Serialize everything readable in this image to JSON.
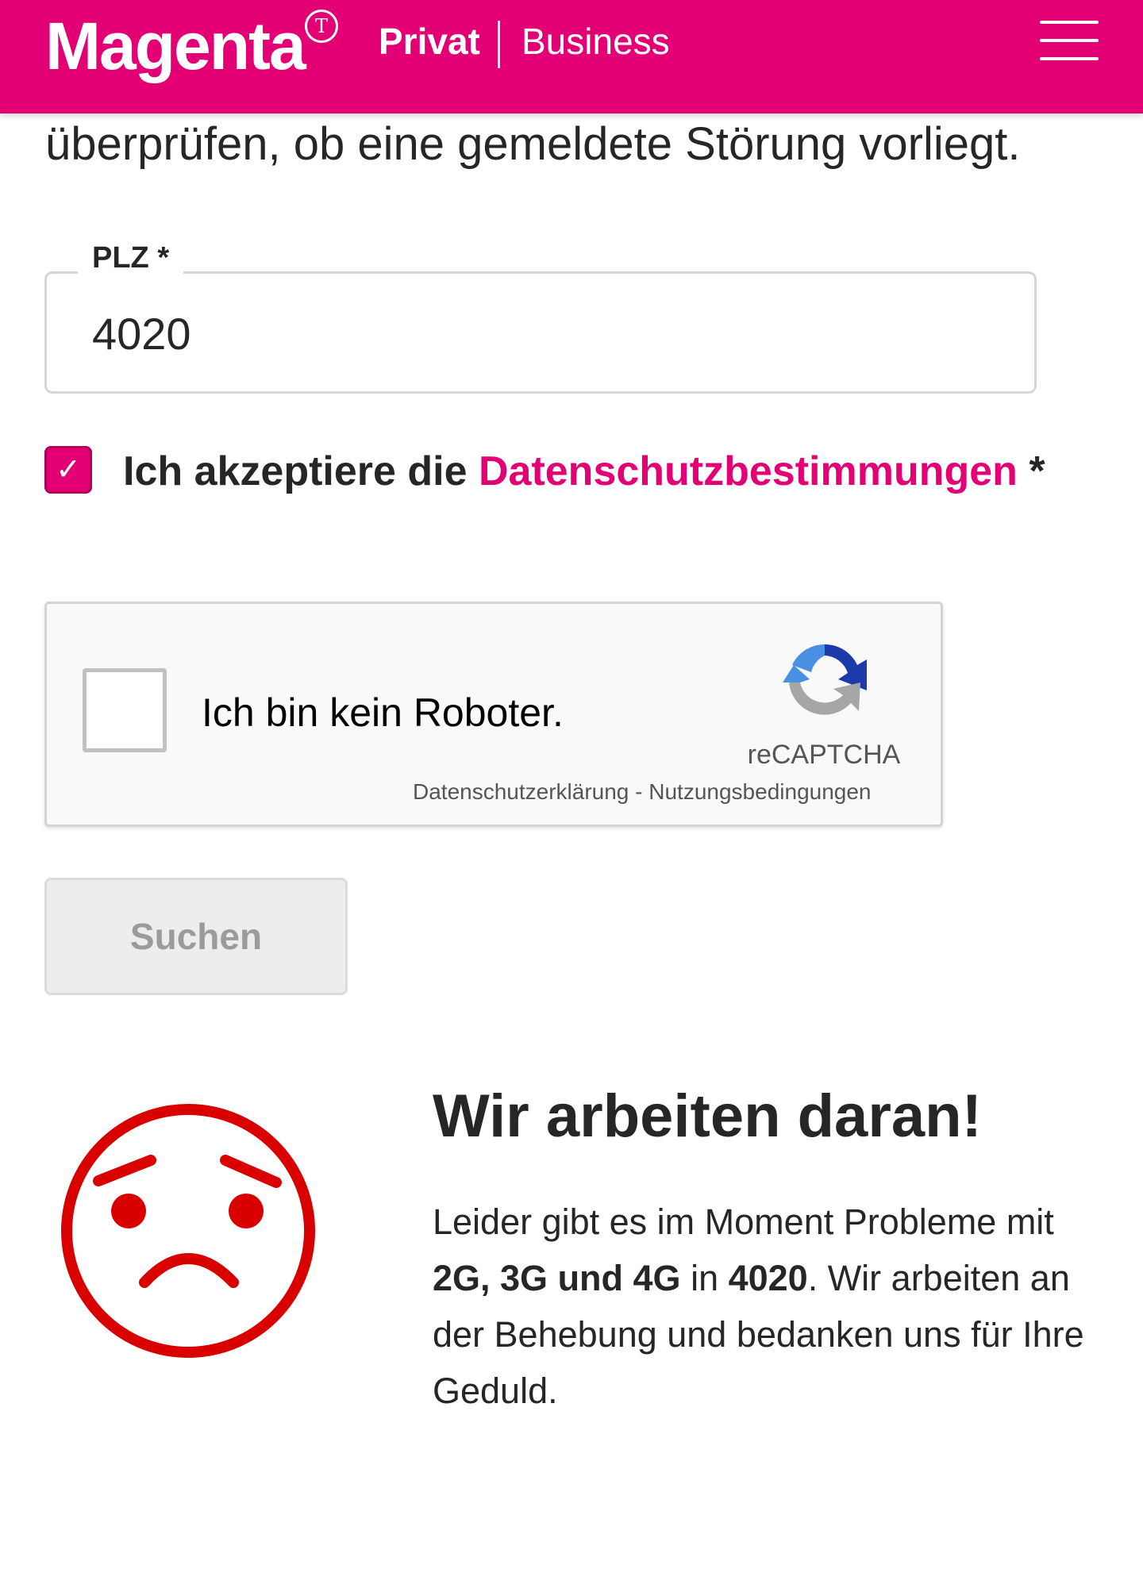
{
  "header": {
    "logo_text": "Magenta",
    "logo_mark": "T",
    "nav_privat": "Privat",
    "nav_business": "Business",
    "menu_icon": "hamburger-menu-icon",
    "brand_color": "#e20074"
  },
  "intro": {
    "text": "überprüfen, ob eine gemeldete Störung vorliegt."
  },
  "plz": {
    "label": "PLZ *",
    "value": "4020"
  },
  "consent": {
    "checked": true,
    "text": "Ich akzeptiere die ",
    "link": "Datenschutzbestimmungen",
    "required_mark": " *"
  },
  "recaptcha": {
    "label": "Ich bin kein Roboter.",
    "brand": "reCAPTCHA",
    "privacy": "Datenschutzerklärung",
    "separator": " - ",
    "terms": "Nutzungsbedingungen",
    "checked": false
  },
  "search": {
    "label": "Suchen",
    "disabled": true
  },
  "status": {
    "icon": "sad-face-icon",
    "icon_color": "#d90000",
    "title": "Wir arbeiten daran!",
    "body_1": "Leider gibt es im Moment Probleme mit ",
    "networks": "2G, 3G und 4G",
    "body_2": " in ",
    "plz": "4020",
    "body_3": ". Wir arbeiten an der Behebung und bedanken uns für Ihre Geduld."
  }
}
